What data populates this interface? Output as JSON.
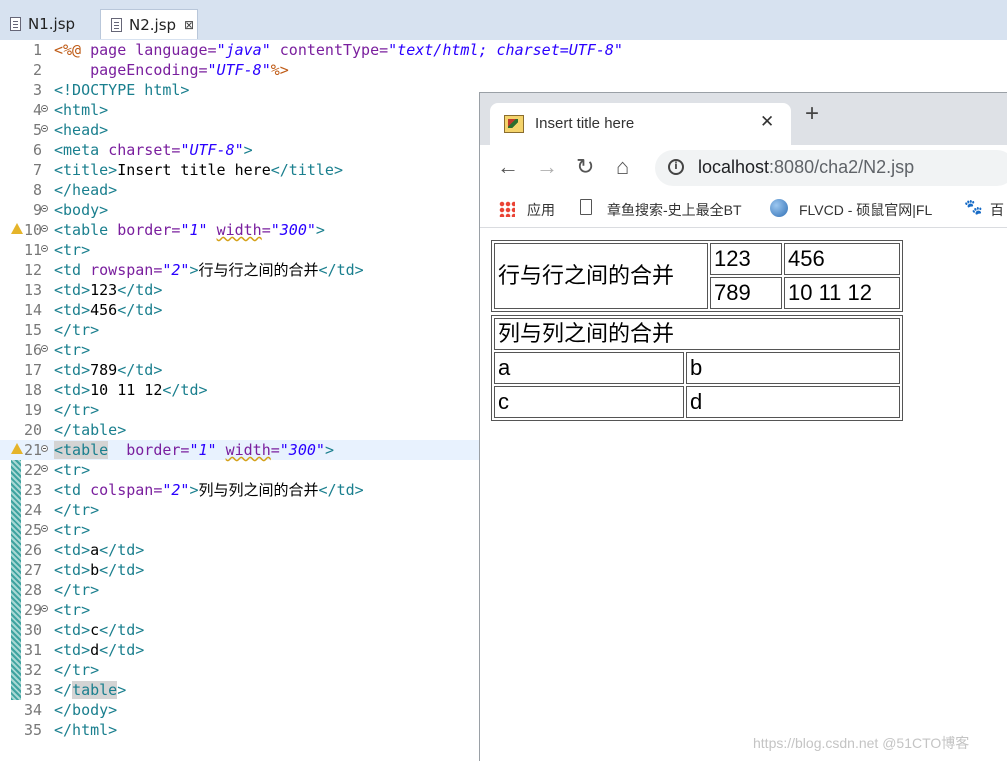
{
  "editor": {
    "tabs": [
      {
        "label": "N1.jsp"
      },
      {
        "label": "N2.jsp",
        "close": "⊠"
      }
    ],
    "lines": [
      {
        "n": "1"
      },
      {
        "n": "2"
      },
      {
        "n": "3"
      },
      {
        "n": "4"
      },
      {
        "n": "5"
      },
      {
        "n": "6"
      },
      {
        "n": "7"
      },
      {
        "n": "8"
      },
      {
        "n": "9"
      },
      {
        "n": "10"
      },
      {
        "n": "11"
      },
      {
        "n": "12"
      },
      {
        "n": "13"
      },
      {
        "n": "14"
      },
      {
        "n": "15"
      },
      {
        "n": "16"
      },
      {
        "n": "17"
      },
      {
        "n": "18"
      },
      {
        "n": "19"
      },
      {
        "n": "20"
      },
      {
        "n": "21"
      },
      {
        "n": "22"
      },
      {
        "n": "23"
      },
      {
        "n": "24"
      },
      {
        "n": "25"
      },
      {
        "n": "26"
      },
      {
        "n": "27"
      },
      {
        "n": "28"
      },
      {
        "n": "29"
      },
      {
        "n": "30"
      },
      {
        "n": "31"
      },
      {
        "n": "32"
      },
      {
        "n": "33"
      },
      {
        "n": "34"
      },
      {
        "n": "35"
      }
    ],
    "code": {
      "l1_a": "<%@ ",
      "l1_b": "page ",
      "l1_c": "language=",
      "l1_d": "\"java\"",
      "l1_e": " contentType=",
      "l1_f": "\"text/html; charset=UTF-8\"",
      "l2_a": "    pageEncoding=",
      "l2_b": "\"UTF-8\"",
      "l2_c": "%>",
      "l3": "<!DOCTYPE html>",
      "l4": "<html>",
      "l5": "<head>",
      "l6_a": "<meta ",
      "l6_b": "charset=",
      "l6_c": "\"UTF-8\"",
      "l6_d": ">",
      "l7_a": "<title>",
      "l7_b": "Insert title here",
      "l7_c": "</title>",
      "l8": "</head>",
      "l9": "<body>",
      "l10_a": "<table ",
      "l10_b": "border=",
      "l10_c": "\"1\"",
      "l10_d": " ",
      "l10_e": "width",
      "l10_f": "=",
      "l10_g": "\"300\"",
      "l10_h": ">",
      "l11": "<tr>",
      "l12_a": "<td ",
      "l12_b": "rowspan=",
      "l12_c": "\"2\"",
      "l12_d": ">",
      "l12_e": "行与行之间的合并",
      "l12_f": "</td>",
      "l13_a": "<td>",
      "l13_b": "123",
      "l13_c": "</td>",
      "l14_a": "<td>",
      "l14_b": "456",
      "l14_c": "</td>",
      "l15": "</tr>",
      "l16": "<tr>",
      "l17_a": "<td>",
      "l17_b": "789",
      "l17_c": "</td>",
      "l18_a": "<td>",
      "l18_b": "10 11 12",
      "l18_c": "</td>",
      "l19": "</tr>",
      "l20": "</table>",
      "l21_a": "<",
      "l21_b": "table",
      "l21_c": "  ",
      "l21_d": "border=",
      "l21_e": "\"1\"",
      "l21_f": " ",
      "l21_g": "width",
      "l21_h": "=",
      "l21_i": "\"300\"",
      "l21_j": ">",
      "l22": "<tr>",
      "l23_a": "<td ",
      "l23_b": "colspan=",
      "l23_c": "\"2\"",
      "l23_d": ">",
      "l23_e": "列与列之间的合并",
      "l23_f": "</td>",
      "l24": "</tr>",
      "l25": "<tr>",
      "l26_a": "<td>",
      "l26_b": "a",
      "l26_c": "</td>",
      "l27_a": "<td>",
      "l27_b": "b",
      "l27_c": "</td>",
      "l28": "</tr>",
      "l29": "<tr>",
      "l30_a": "<td>",
      "l30_b": "c",
      "l30_c": "</td>",
      "l31_a": "<td>",
      "l31_b": "d",
      "l31_c": "</td>",
      "l32": "</tr>",
      "l33_a": "</",
      "l33_b": "table",
      "l33_c": ">",
      "l34": "</body>",
      "l35": "</html>"
    }
  },
  "browser": {
    "tab_title": "Insert title here",
    "tab_close": "✕",
    "new_tab": "+",
    "back": "←",
    "forward": "→",
    "reload": "↻",
    "home": "⌂",
    "info": "i",
    "url_host": "localhost",
    "url_rest": ":8080/cha2/N2.jsp",
    "bookmarks": {
      "apps": "应用",
      "zhangyu": "章鱼搜索-史上最全BT",
      "flvcd": "FLVCD - 硕鼠官网|FL",
      "bai": "百"
    },
    "table1": {
      "merged": "行与行之间的合并",
      "r1c2": "123",
      "r1c3": "456",
      "r2c2": "789",
      "r2c3": "10 11 12"
    },
    "table2": {
      "merged": "列与列之间的合并",
      "r2c1": "a",
      "r2c2": "b",
      "r3c1": "c",
      "r3c2": "d"
    }
  },
  "watermark": "https://blog.csdn.net @51CTO博客"
}
